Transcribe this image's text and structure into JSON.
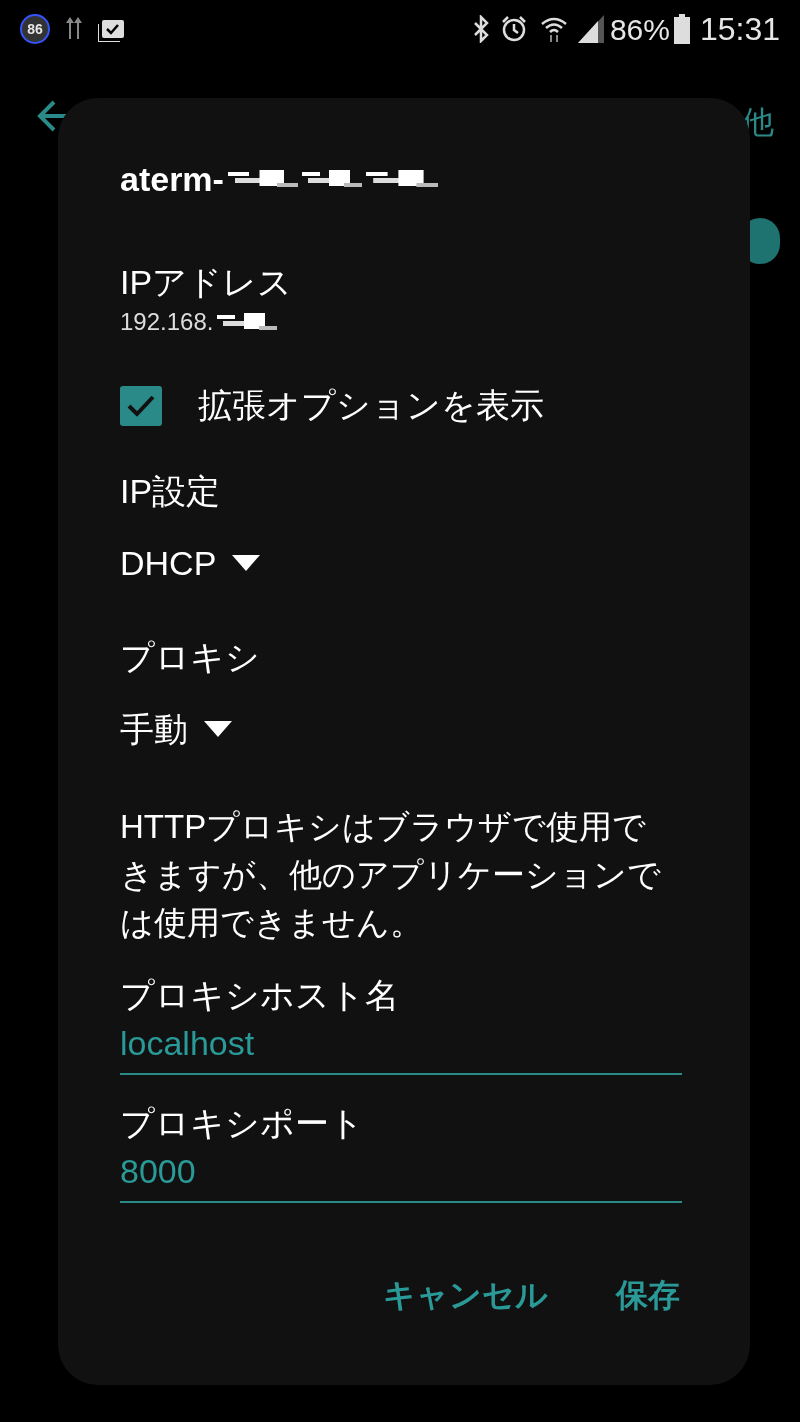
{
  "status_bar": {
    "badge": "86",
    "battery": "86%",
    "time": "15:31"
  },
  "background": {
    "title_tail": "他",
    "toggle_on": true
  },
  "dialog": {
    "title": "aterm-",
    "ip_label": "IPアドレス",
    "ip_value": "192.168.",
    "advanced": {
      "label": "拡張オプションを表示",
      "checked": true
    },
    "ip_settings": {
      "label": "IP設定",
      "value": "DHCP"
    },
    "proxy": {
      "label": "プロキシ",
      "value": "手動"
    },
    "note": "HTTPプロキシはブラウザで使用できますが、他のアプリケーションでは使用できません。",
    "fields": [
      {
        "label": "プロキシホスト名",
        "value": "localhost"
      },
      {
        "label": "プロキシポート",
        "value": "8000"
      }
    ],
    "buttons": [
      "キャンセル",
      "保存"
    ]
  }
}
